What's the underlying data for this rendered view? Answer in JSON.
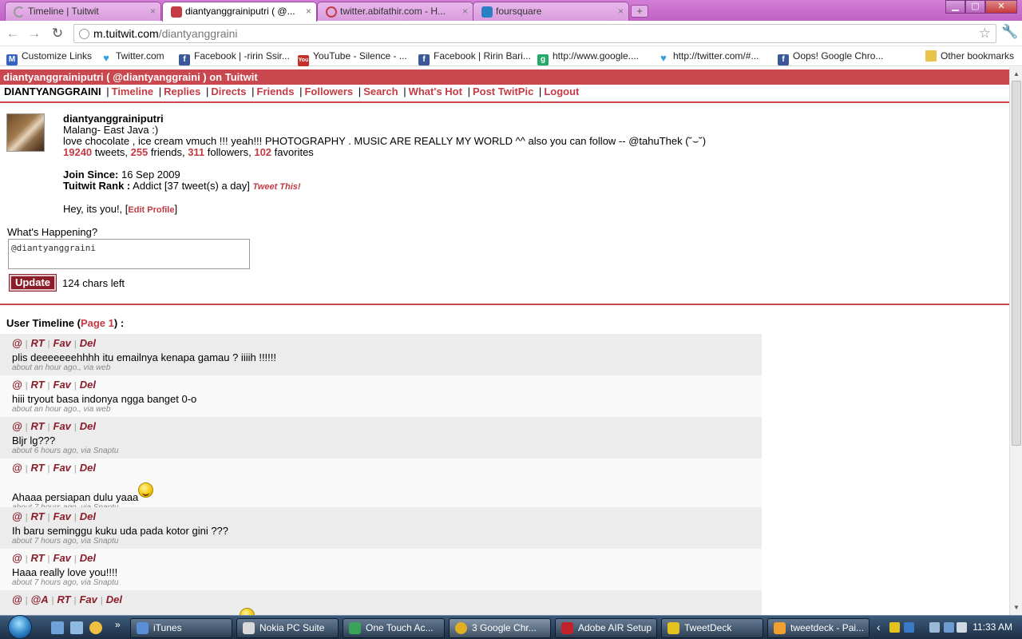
{
  "browser": {
    "tabs": [
      {
        "label": "Timeline | Tuitwit",
        "active": false
      },
      {
        "label": "diantyanggrainiputri ( @...",
        "active": true
      },
      {
        "label": "twitter.abifathir.com - H...",
        "active": false
      },
      {
        "label": "foursquare",
        "active": false
      }
    ],
    "close_glyph": "×",
    "new_tab_glyph": "+",
    "window_buttons": {
      "minimize": "▁",
      "maximize": "▢",
      "close": "✕"
    },
    "url_host": "m.tuitwit.com",
    "url_path": "/diantyanggraini",
    "nav_icons": {
      "back": "←",
      "forward": "→",
      "reload": "↻",
      "star": "☆",
      "wrench": "🔧"
    }
  },
  "bookmarks": [
    {
      "label": "Customize Links",
      "icon": "customize-links-icon"
    },
    {
      "label": "Twitter.com",
      "icon": "twitter-bird-icon"
    },
    {
      "label": "Facebook | -ririn Ssir...",
      "icon": "facebook-icon"
    },
    {
      "label": "YouTube - Silence - ...",
      "icon": "youtube-icon"
    },
    {
      "label": "Facebook | Ririn Bari...",
      "icon": "facebook-icon"
    },
    {
      "label": "http://www.google....",
      "icon": "google-icon"
    },
    {
      "label": "http://twitter.com/#...",
      "icon": "twitter-bird-icon"
    },
    {
      "label": "Oops! Google Chro...",
      "icon": "facebook-icon"
    },
    {
      "label": "Other bookmarks",
      "icon": "folder-icon"
    }
  ],
  "site": {
    "header": "diantyanggrainiputri ( @diantyanggraini ) on Tuitwit",
    "nav_user": "DIANTYANGGRAINI",
    "nav_links": [
      "Timeline",
      "Replies",
      "Directs",
      "Friends",
      "Followers",
      "Search",
      "What's Hot",
      "Post TwitPic",
      "Logout"
    ],
    "nav_separator": "|"
  },
  "profile": {
    "username": "diantyanggrainiputri",
    "location": "Malang- East Java :)",
    "bio": "love chocolate , ice cream vmuch !!! yeah!!! PHOTOGRAPHY . MUSIC ARE REALLY MY WORLD ^^ also you can follow -- @tahuThek (˘⌣˘)",
    "tweets": "19240",
    "tweets_label": "tweets,",
    "friends": "255",
    "friends_label": "friends,",
    "followers": "311",
    "followers_label": "followers,",
    "favorites": "102",
    "favorites_label": "favorites",
    "join_label": "Join Since:",
    "join_date": "16 Sep 2009",
    "rank_label": "Tuitwit Rank :",
    "rank_value": "Addict [37 tweet(s) a day]",
    "tweet_this": "Tweet This!",
    "self_note": "Hey, its you!, [",
    "edit_profile": "Edit Profile",
    "self_note_end": "]"
  },
  "composer": {
    "label": "What's Happening?",
    "value": "@diantyanggraini",
    "button": "Update",
    "chars_left": "124 chars left"
  },
  "timeline": {
    "title_prefix": "User Timeline (",
    "page_label": "Page 1",
    "title_suffix": ") :",
    "action_separator": "|",
    "tweets": [
      {
        "actions": [
          "@",
          "RT",
          "Fav",
          "Del"
        ],
        "text": "plis deeeeeeehhhh itu emailnya kenapa gamau ? iiiih !!!!!!",
        "meta": "about an hour ago., via web",
        "emoji": false
      },
      {
        "actions": [
          "@",
          "RT",
          "Fav",
          "Del"
        ],
        "text": "hiii tryout basa indonya ngga banget 0-o",
        "meta": "about an hour ago., via web",
        "emoji": false
      },
      {
        "actions": [
          "@",
          "RT",
          "Fav",
          "Del"
        ],
        "text": "Bljr lg???",
        "meta": "about 6 hours ago, via Snaptu",
        "emoji": false
      },
      {
        "actions": [
          "@",
          "RT",
          "Fav",
          "Del"
        ],
        "text": "Ahaaa persiapan dulu yaaa",
        "meta": "about 7 hours ago, via Snaptu",
        "emoji": true
      },
      {
        "actions": [
          "@",
          "RT",
          "Fav",
          "Del"
        ],
        "text": "Ih baru seminggu kuku uda pada kotor gini ???",
        "meta": "about 7 hours ago, via Snaptu",
        "emoji": false
      },
      {
        "actions": [
          "@",
          "RT",
          "Fav",
          "Del"
        ],
        "text": "Haaa really love you!!!!",
        "meta": "about 7 hours ago, via Snaptu",
        "emoji": false
      },
      {
        "actions": [
          "@",
          "@A",
          "RT",
          "Fav",
          "Del"
        ],
        "text": "",
        "meta": "",
        "emoji": true
      }
    ]
  },
  "taskbar": {
    "tasks": [
      {
        "label": "iTunes",
        "color": "#5a8fd6"
      },
      {
        "label": "Nokia PC Suite",
        "color": "#d9d9d9"
      },
      {
        "label": "One Touch Ac...",
        "color": "#3aa35a"
      },
      {
        "label": "3 Google Chr...",
        "color": "#e0b020"
      },
      {
        "label": "Adobe AIR Setup",
        "color": "#c0242a"
      },
      {
        "label": "TweetDeck",
        "color": "#e5c31e"
      },
      {
        "label": "tweetdeck - Pai...",
        "color": "#f0a030"
      }
    ],
    "quick_launch_more": "»",
    "tray_arrow": "‹",
    "clock": "11:33 AM"
  }
}
